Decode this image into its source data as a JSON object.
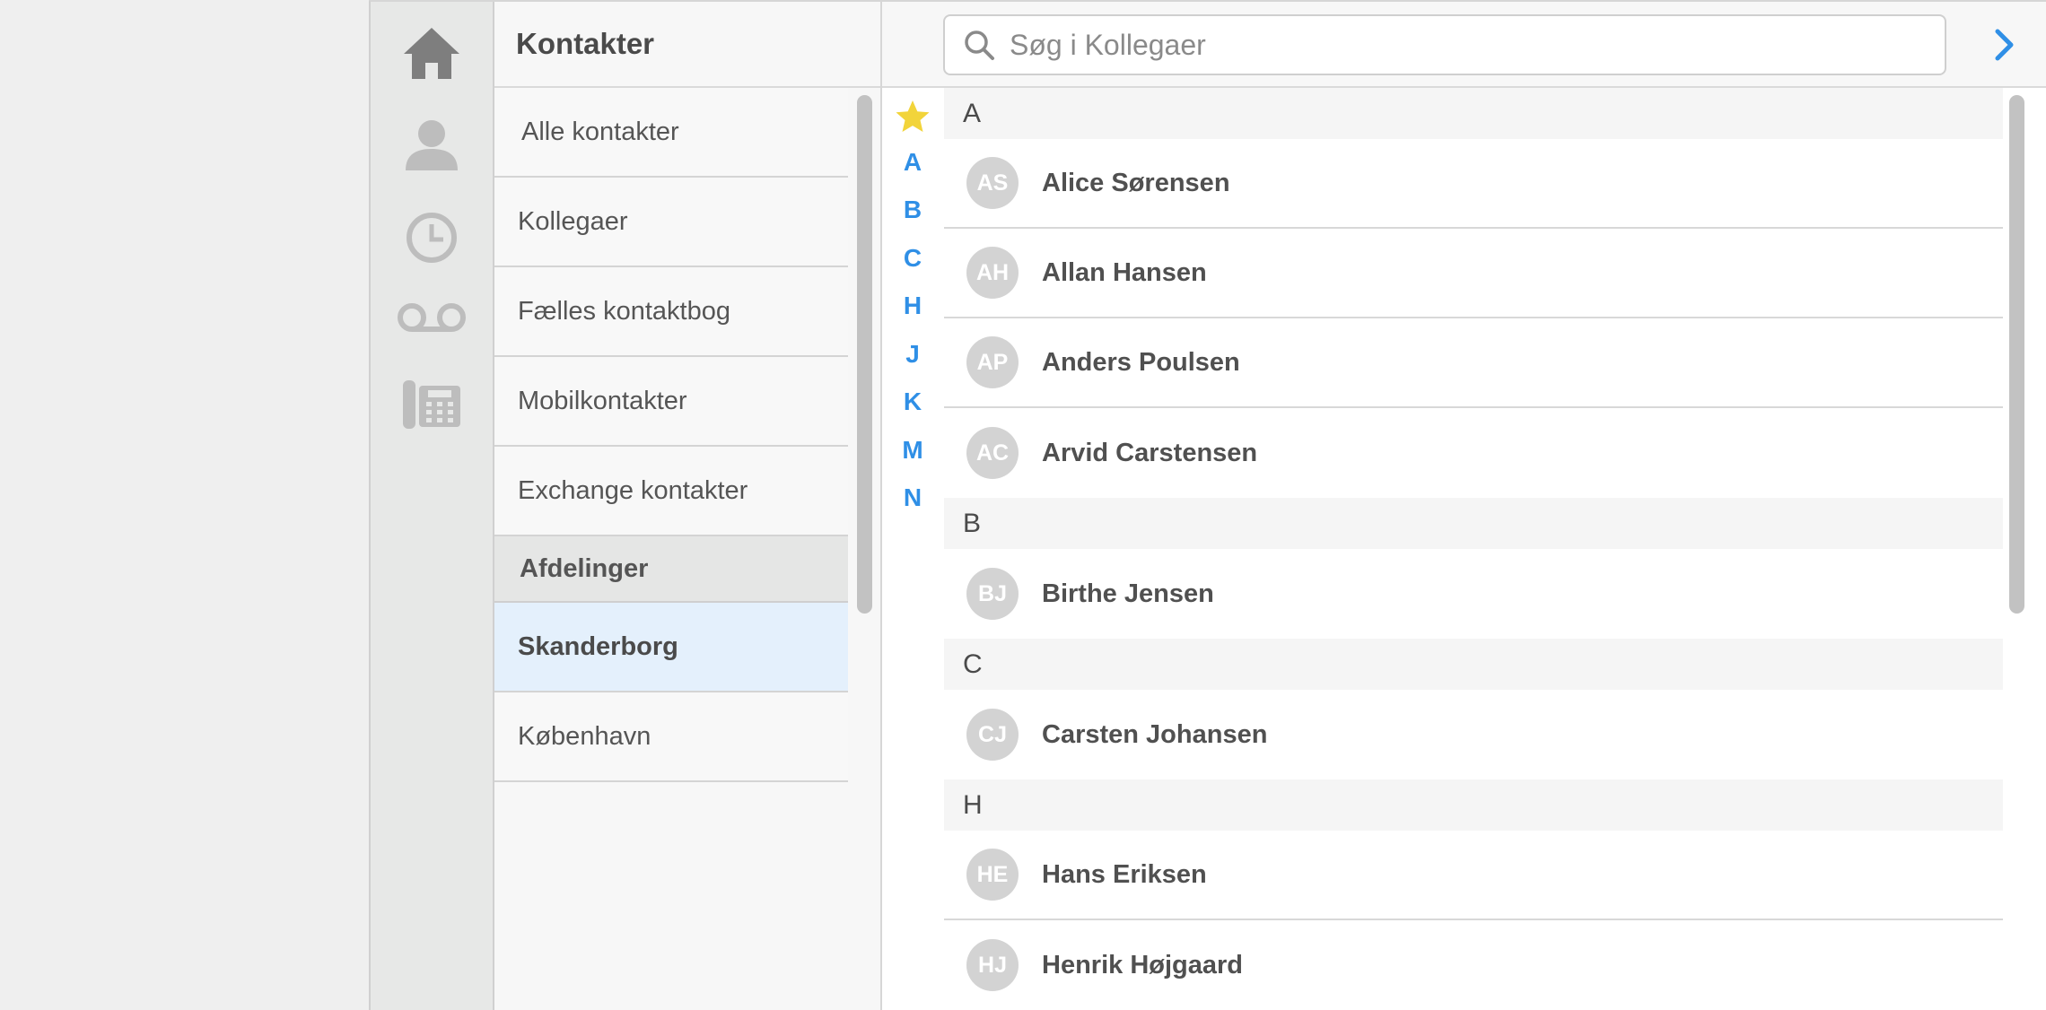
{
  "rail": {
    "items": [
      {
        "icon": "home-icon"
      },
      {
        "icon": "person-icon"
      },
      {
        "icon": "clock-icon"
      },
      {
        "icon": "voicemail-icon"
      },
      {
        "icon": "desk-phone-icon"
      }
    ]
  },
  "categories": {
    "title": "Kontakter",
    "items": [
      "Alle kontakter",
      "Kollegaer",
      "Fælles kontaktbog",
      "Mobilkontakter",
      "Exchange kontakter"
    ],
    "section_title": "Afdelinger",
    "departments": [
      "Skanderborg",
      "København"
    ],
    "active_department": "Skanderborg"
  },
  "search": {
    "placeholder": "Søg i Kollegaer"
  },
  "index": {
    "letters": [
      "A",
      "B",
      "C",
      "H",
      "J",
      "K",
      "M",
      "N"
    ],
    "star_color": "#f2d43a"
  },
  "contacts": [
    {
      "letter": "A",
      "people": [
        {
          "initials": "AS",
          "name": "Alice Sørensen"
        },
        {
          "initials": "AH",
          "name": "Allan Hansen"
        },
        {
          "initials": "AP",
          "name": "Anders Poulsen"
        },
        {
          "initials": "AC",
          "name": "Arvid Carstensen"
        }
      ]
    },
    {
      "letter": "B",
      "people": [
        {
          "initials": "BJ",
          "name": "Birthe Jensen"
        }
      ]
    },
    {
      "letter": "C",
      "people": [
        {
          "initials": "CJ",
          "name": "Carsten Johansen"
        }
      ]
    },
    {
      "letter": "H",
      "people": [
        {
          "initials": "HE",
          "name": "Hans Eriksen"
        },
        {
          "initials": "HJ",
          "name": "Henrik Højgaard"
        }
      ]
    }
  ],
  "colors": {
    "accent": "#2f8fe6",
    "active_row": "#e4f0fc",
    "rail_bg": "#e7e8e7"
  }
}
